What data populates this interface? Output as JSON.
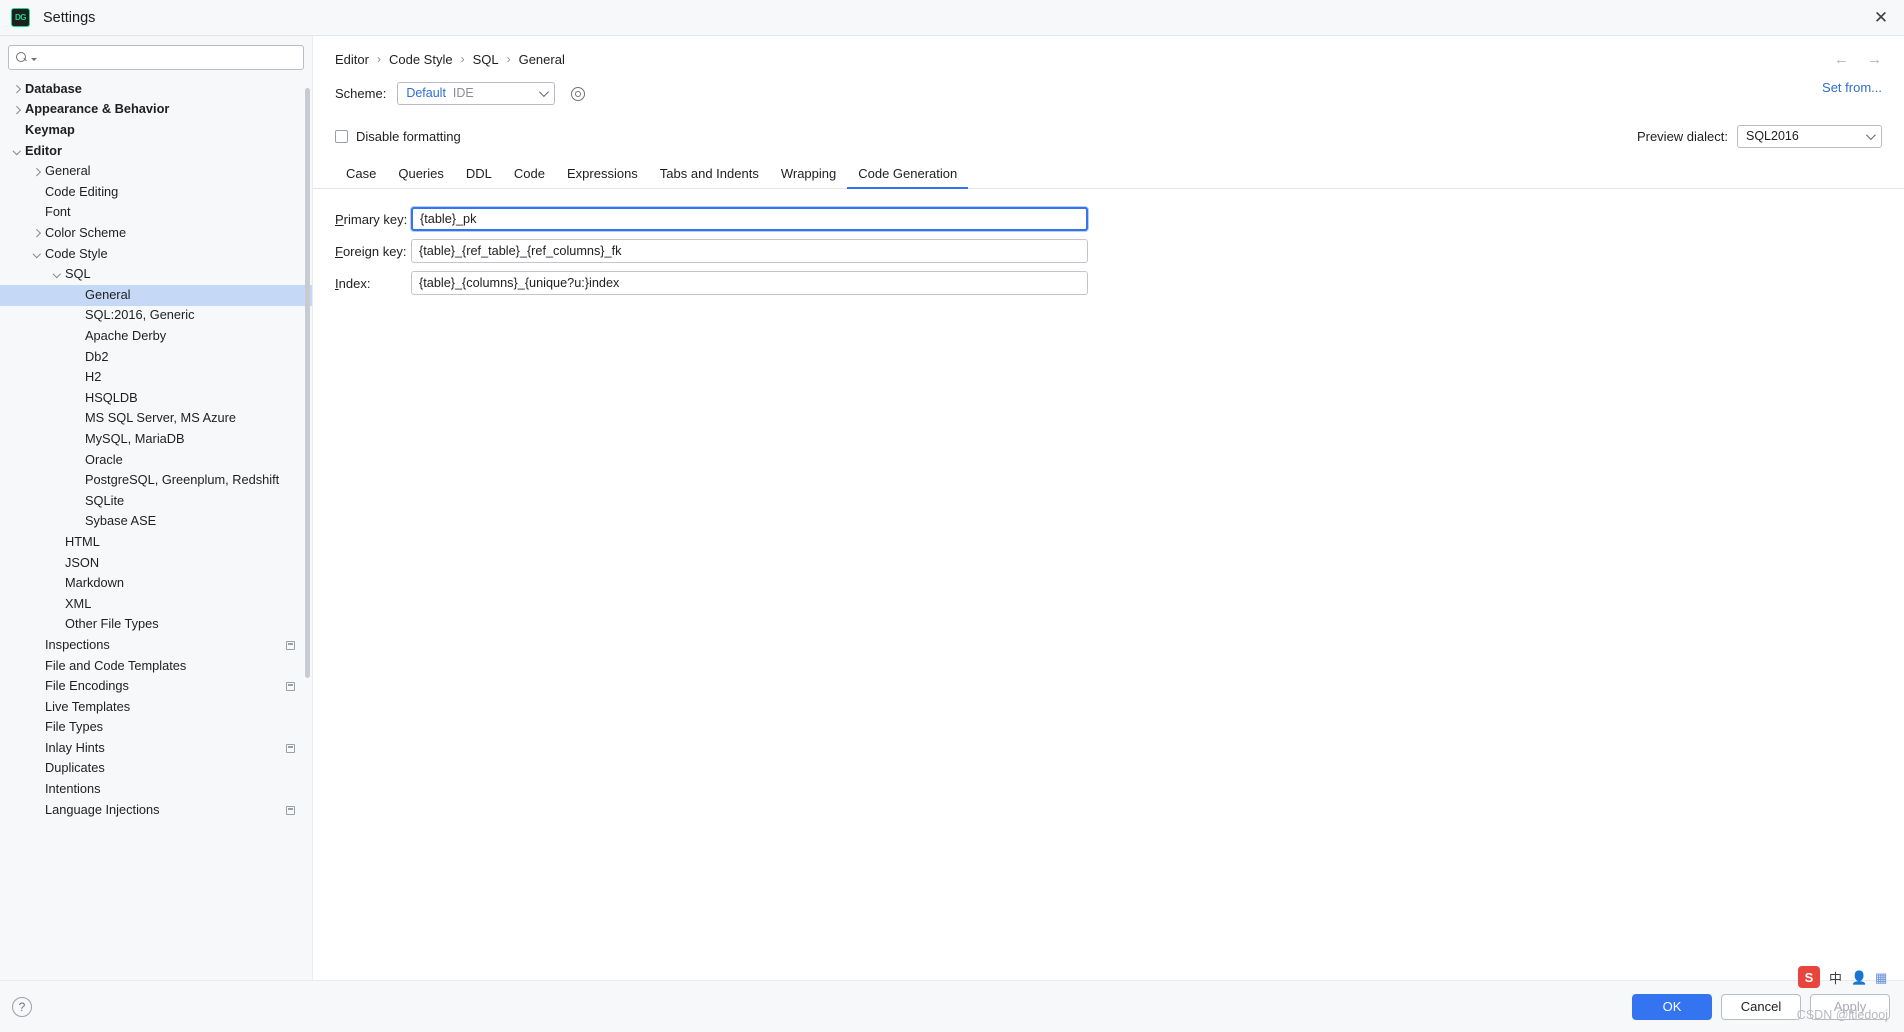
{
  "window": {
    "app_icon": "datagrip-icon",
    "title": "Settings",
    "close_label": "✕"
  },
  "sidebar": {
    "search": {
      "placeholder": "",
      "value": "",
      "icon": "search-icon"
    },
    "items": [
      {
        "label": "Database",
        "indent": 0,
        "chevron": "right",
        "bold": true
      },
      {
        "label": "Appearance & Behavior",
        "indent": 0,
        "chevron": "right",
        "bold": true
      },
      {
        "label": "Keymap",
        "indent": 0,
        "chevron": "none",
        "bold": true
      },
      {
        "label": "Editor",
        "indent": 0,
        "chevron": "down",
        "bold": true
      },
      {
        "label": "General",
        "indent": 1,
        "chevron": "right",
        "bold": false
      },
      {
        "label": "Code Editing",
        "indent": 1,
        "chevron": "none",
        "bold": false
      },
      {
        "label": "Font",
        "indent": 1,
        "chevron": "none",
        "bold": false
      },
      {
        "label": "Color Scheme",
        "indent": 1,
        "chevron": "right",
        "bold": false
      },
      {
        "label": "Code Style",
        "indent": 1,
        "chevron": "down",
        "bold": false
      },
      {
        "label": "SQL",
        "indent": 2,
        "chevron": "down",
        "bold": false
      },
      {
        "label": "General",
        "indent": 3,
        "chevron": "none",
        "bold": false,
        "selected": true
      },
      {
        "label": "SQL:2016, Generic",
        "indent": 3,
        "chevron": "none",
        "bold": false
      },
      {
        "label": "Apache Derby",
        "indent": 3,
        "chevron": "none",
        "bold": false
      },
      {
        "label": "Db2",
        "indent": 3,
        "chevron": "none",
        "bold": false
      },
      {
        "label": "H2",
        "indent": 3,
        "chevron": "none",
        "bold": false
      },
      {
        "label": "HSQLDB",
        "indent": 3,
        "chevron": "none",
        "bold": false
      },
      {
        "label": "MS SQL Server, MS Azure",
        "indent": 3,
        "chevron": "none",
        "bold": false
      },
      {
        "label": "MySQL, MariaDB",
        "indent": 3,
        "chevron": "none",
        "bold": false
      },
      {
        "label": "Oracle",
        "indent": 3,
        "chevron": "none",
        "bold": false
      },
      {
        "label": "PostgreSQL, Greenplum, Redshift",
        "indent": 3,
        "chevron": "none",
        "bold": false
      },
      {
        "label": "SQLite",
        "indent": 3,
        "chevron": "none",
        "bold": false
      },
      {
        "label": "Sybase ASE",
        "indent": 3,
        "chevron": "none",
        "bold": false
      },
      {
        "label": "HTML",
        "indent": 2,
        "chevron": "none",
        "bold": false
      },
      {
        "label": "JSON",
        "indent": 2,
        "chevron": "none",
        "bold": false
      },
      {
        "label": "Markdown",
        "indent": 2,
        "chevron": "none",
        "bold": false
      },
      {
        "label": "XML",
        "indent": 2,
        "chevron": "none",
        "bold": false
      },
      {
        "label": "Other File Types",
        "indent": 2,
        "chevron": "none",
        "bold": false
      },
      {
        "label": "Inspections",
        "indent": 1,
        "chevron": "none",
        "bold": false,
        "scope_icon": true
      },
      {
        "label": "File and Code Templates",
        "indent": 1,
        "chevron": "none",
        "bold": false
      },
      {
        "label": "File Encodings",
        "indent": 1,
        "chevron": "none",
        "bold": false,
        "scope_icon": true
      },
      {
        "label": "Live Templates",
        "indent": 1,
        "chevron": "none",
        "bold": false
      },
      {
        "label": "File Types",
        "indent": 1,
        "chevron": "none",
        "bold": false
      },
      {
        "label": "Inlay Hints",
        "indent": 1,
        "chevron": "none",
        "bold": false,
        "scope_icon": true
      },
      {
        "label": "Duplicates",
        "indent": 1,
        "chevron": "none",
        "bold": false
      },
      {
        "label": "Intentions",
        "indent": 1,
        "chevron": "none",
        "bold": false
      },
      {
        "label": "Language Injections",
        "indent": 1,
        "chevron": "none",
        "bold": false,
        "scope_icon": true
      }
    ]
  },
  "main": {
    "breadcrumb": [
      "Editor",
      "Code Style",
      "SQL",
      "General"
    ],
    "breadcrumb_separator": "›",
    "nav_back": "←",
    "nav_forward": "→",
    "scheme": {
      "label": "Scheme:",
      "value": "Default",
      "value_secondary": "IDE",
      "gear_icon": "gear-icon"
    },
    "set_from_label": "Set from...",
    "disable_formatting": {
      "label": "Disable formatting",
      "checked": false
    },
    "preview_dialect": {
      "label": "Preview dialect:",
      "value": "SQL2016"
    },
    "tabs": [
      {
        "label": "Case",
        "active": false
      },
      {
        "label": "Queries",
        "active": false
      },
      {
        "label": "DDL",
        "active": false
      },
      {
        "label": "Code",
        "active": false
      },
      {
        "label": "Expressions",
        "active": false
      },
      {
        "label": "Tabs and Indents",
        "active": false
      },
      {
        "label": "Wrapping",
        "active": false
      },
      {
        "label": "Code Generation",
        "active": true
      }
    ],
    "fields": [
      {
        "mnemonic": "P",
        "label_rest": "rimary key:",
        "value": "{table}_pk",
        "focused": true
      },
      {
        "mnemonic": "F",
        "label_rest": "oreign key:",
        "value": "{table}_{ref_table}_{ref_columns}_fk",
        "focused": false
      },
      {
        "mnemonic": "I",
        "label_rest": "ndex:",
        "value": "{table}_{columns}_{unique?u:}index",
        "focused": false
      }
    ]
  },
  "footer": {
    "help_label": "?",
    "ok_label": "OK",
    "cancel_label": "Cancel",
    "apply_label": "Apply"
  },
  "overlay": {
    "ime_logo": "S",
    "ime_mode": "中",
    "ime_user_icon": "user-icon",
    "ime_grid_icon": "grid-icon",
    "watermark": "CSDN @ltledooj"
  },
  "colors": {
    "accent": "#3574f0",
    "selection": "#c5d9f7",
    "link": "#2f6ed4",
    "background": "#f7f8fa"
  }
}
